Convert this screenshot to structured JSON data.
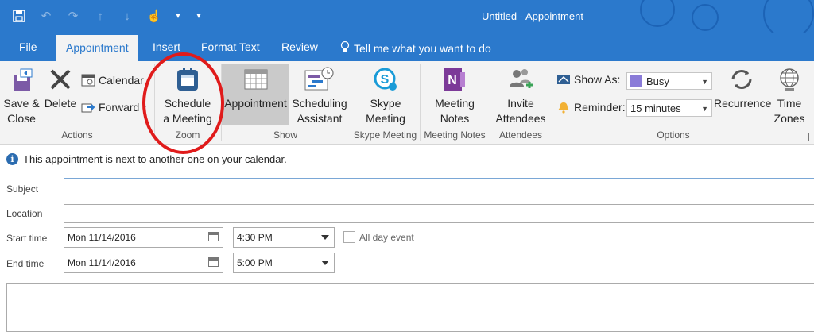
{
  "window": {
    "title": "Untitled - Appointment"
  },
  "quick_access": {
    "icons": [
      "save-icon",
      "undo-icon",
      "redo-icon",
      "up-arrow-icon",
      "down-arrow-icon",
      "touch-mode-icon",
      "customize-qat-icon"
    ]
  },
  "tabs": [
    {
      "label": "File"
    },
    {
      "label": "Appointment"
    },
    {
      "label": "Insert"
    },
    {
      "label": "Format Text"
    },
    {
      "label": "Review"
    }
  ],
  "tell_me": "Tell me what you want to do",
  "ribbon": {
    "actions": {
      "save_close": [
        "Save &",
        "Close"
      ],
      "delete": "Delete",
      "calendar": "Calendar",
      "forward": "Forward",
      "group_label": "Actions"
    },
    "zoom": {
      "schedule": [
        "Schedule",
        "a Meeting"
      ],
      "group_label": "Zoom"
    },
    "show": {
      "appointment": "Appointment",
      "scheduling": [
        "Scheduling",
        "Assistant"
      ],
      "group_label": "Show"
    },
    "skype": {
      "label": [
        "Skype",
        "Meeting"
      ],
      "group_label": "Skype Meeting"
    },
    "notes": {
      "label": [
        "Meeting",
        "Notes"
      ],
      "group_label": "Meeting Notes"
    },
    "attendees": {
      "label": [
        "Invite",
        "Attendees"
      ],
      "group_label": "Attendees"
    },
    "options": {
      "show_as_label": "Show As:",
      "show_as_value": "Busy",
      "reminder_label": "Reminder:",
      "reminder_value": "15 minutes",
      "recurrence": "Recurrence",
      "time_zones": [
        "Time",
        "Zones"
      ],
      "group_label": "Options"
    }
  },
  "info_message": "This appointment is next to another one on your calendar.",
  "form": {
    "subject_label": "Subject",
    "subject_value": "",
    "location_label": "Location",
    "location_value": "",
    "start_label": "Start time",
    "start_date": "Mon 11/14/2016",
    "start_time": "4:30 PM",
    "all_day_label": "All day event",
    "end_label": "End time",
    "end_date": "Mon 11/14/2016",
    "end_time": "5:00 PM"
  },
  "colors": {
    "brand": "#2b79cc",
    "busy": "#8a7bd8",
    "annotation": "#e01b1b"
  }
}
